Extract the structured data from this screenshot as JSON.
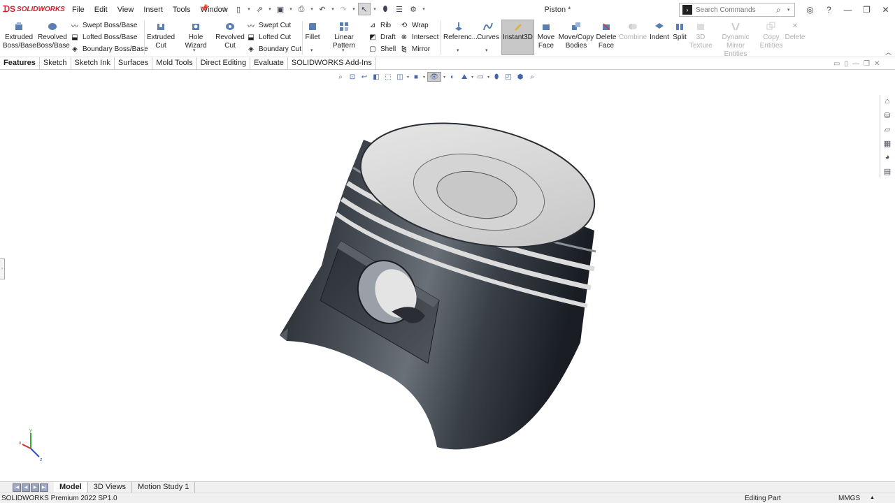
{
  "app": {
    "brand": "SOLIDWORKS",
    "document_title": "Piston *"
  },
  "menu": [
    "File",
    "Edit",
    "View",
    "Insert",
    "Tools",
    "Window"
  ],
  "search": {
    "placeholder": "Search Commands"
  },
  "ribbon": {
    "extruded_boss": "Extruded Boss/Base",
    "revolved_boss": "Revolved Boss/Base",
    "swept_boss": "Swept Boss/Base",
    "lofted_boss": "Lofted Boss/Base",
    "boundary_boss": "Boundary Boss/Base",
    "extruded_cut": "Extruded Cut",
    "hole_wizard": "Hole Wizard",
    "revolved_cut": "Revolved Cut",
    "swept_cut": "Swept Cut",
    "lofted_cut": "Lofted Cut",
    "boundary_cut": "Boundary Cut",
    "fillet": "Fillet",
    "linear_pattern": "Linear Pattern",
    "rib": "Rib",
    "draft": "Draft",
    "shell": "Shell",
    "wrap": "Wrap",
    "intersect": "Intersect",
    "mirror": "Mirror",
    "reference": "Referenc...",
    "curves": "Curves",
    "instant3d": "Instant3D",
    "move_face": "Move Face",
    "move_copy_bodies": "Move/Copy Bodies",
    "delete_face": "Delete Face",
    "combine": "Combine",
    "indent": "Indent",
    "split": "Split",
    "texture_3d": "3D Texture",
    "dynamic_mirror": "Dynamic Mirror Entities",
    "copy_entities": "Copy Entities",
    "delete": "Delete"
  },
  "tabs": [
    "Features",
    "Sketch",
    "Sketch Ink",
    "Surfaces",
    "Mold Tools",
    "Direct Editing",
    "Evaluate",
    "SOLIDWORKS Add-Ins"
  ],
  "bottom_tabs": [
    "Model",
    "3D Views",
    "Motion Study 1"
  ],
  "status": {
    "product": "SOLIDWORKS Premium 2022 SP1.0",
    "mode": "Editing Part",
    "units": "MMGS"
  },
  "triad": {
    "x": "x",
    "y": "y",
    "z": "z"
  },
  "colors": {
    "brand_red": "#d0202a",
    "instant3d_bg": "#c8c8c8",
    "model_dark": "#2c3138",
    "model_light": "#d6d6d6"
  }
}
